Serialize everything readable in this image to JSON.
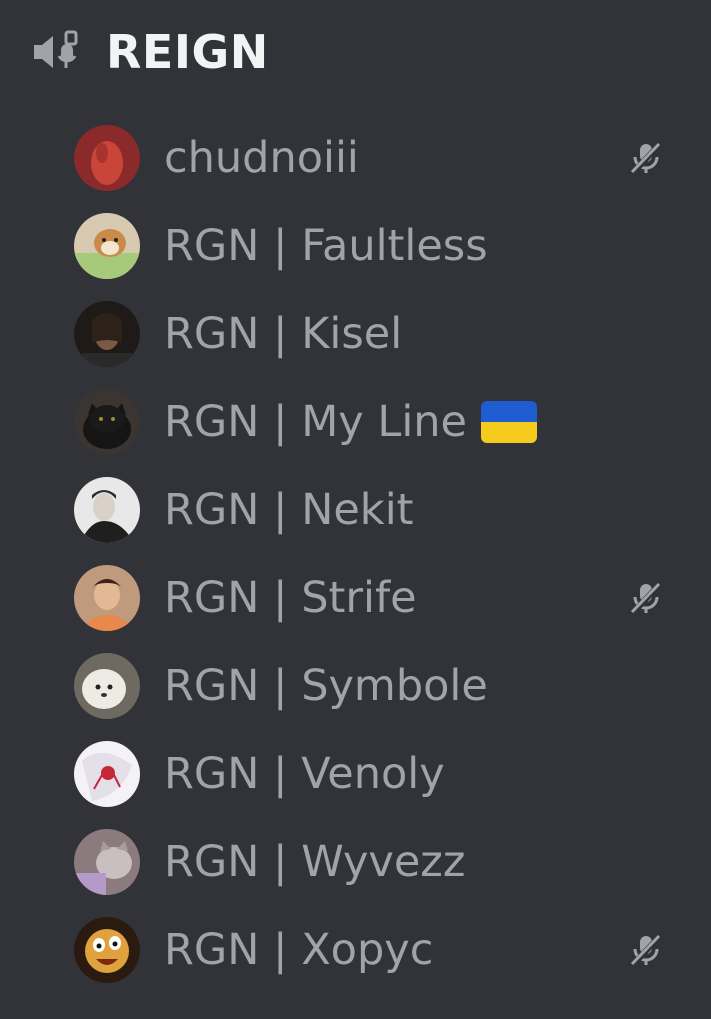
{
  "channel": {
    "name": "REIGN",
    "icon": "voice-channel-icon"
  },
  "users": [
    {
      "name": "chudnoiii",
      "muted": true,
      "avatar": {
        "bg": "#8b2a2a",
        "accent": "#c9453a"
      }
    },
    {
      "name": "RGN | Faultless",
      "muted": false,
      "avatar": {
        "bg": "#d8c9b1",
        "accent": "#c98a4a"
      }
    },
    {
      "name": "RGN | Kisel",
      "muted": false,
      "avatar": {
        "bg": "#1e1a17",
        "accent": "#7a5a44"
      }
    },
    {
      "name": "RGN | My Line",
      "muted": false,
      "flag": "ukraine-flag-icon",
      "avatar": {
        "bg": "#3a3530",
        "accent": "#151515"
      }
    },
    {
      "name": "RGN | Nekit",
      "muted": false,
      "avatar": {
        "bg": "#e8e8e8",
        "accent": "#1f1f1f"
      }
    },
    {
      "name": "RGN | Strife",
      "muted": true,
      "avatar": {
        "bg": "#c09a7c",
        "accent": "#3a2518"
      }
    },
    {
      "name": "RGN | Symbole",
      "muted": false,
      "avatar": {
        "bg": "#6e6a62",
        "accent": "#eeebe4"
      }
    },
    {
      "name": "RGN | Venoly",
      "muted": false,
      "avatar": {
        "bg": "#f4f2f6",
        "accent": "#c6283a"
      }
    },
    {
      "name": "RGN | Wyvezz",
      "muted": false,
      "avatar": {
        "bg": "#8b7b7e",
        "accent": "#c8bfc0"
      }
    },
    {
      "name": "RGN | Xopyc",
      "muted": true,
      "avatar": {
        "bg": "#2a1a10",
        "accent": "#e0a23c"
      }
    }
  ],
  "colors": {
    "background": "#313338",
    "username": "#a0a3aa",
    "title": "#f2f3f5",
    "icon": "#a0a3aa",
    "flag_top": "#1f5bd1",
    "flag_bottom": "#f5cc1e"
  }
}
